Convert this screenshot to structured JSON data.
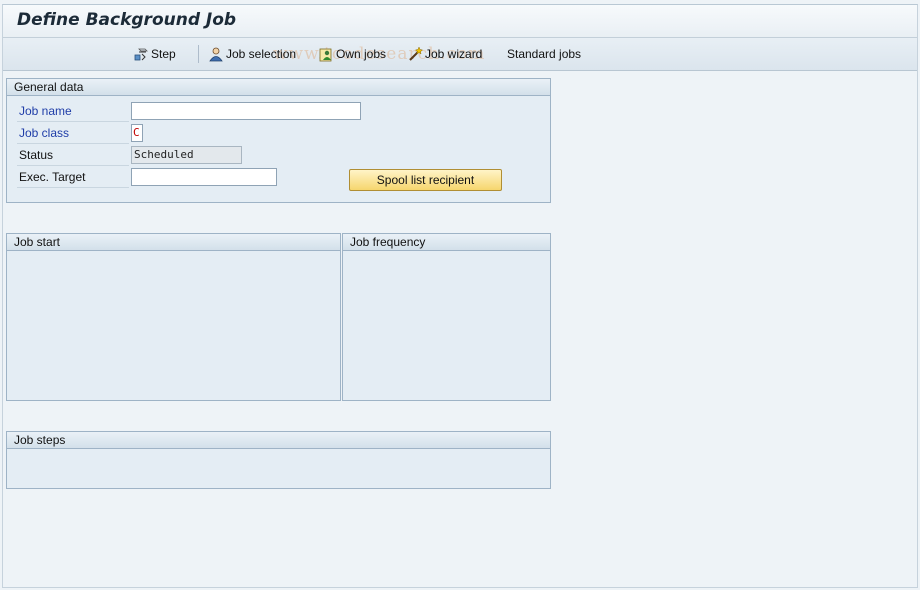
{
  "window": {
    "title": "Define Background Job"
  },
  "toolbar": {
    "items": [
      {
        "label": "Step",
        "icon": "step-icon"
      },
      {
        "label": "Job selection",
        "icon": "job-selection-icon"
      },
      {
        "label": "Own jobs",
        "icon": "own-jobs-icon"
      },
      {
        "label": "Job wizard",
        "icon": "job-wizard-icon"
      },
      {
        "label": "Standard jobs",
        "icon": ""
      }
    ]
  },
  "watermark": "www.tcodesearch.com",
  "general_data": {
    "title": "General data",
    "fields": {
      "job_name": {
        "label": "Job name",
        "value": ""
      },
      "job_class": {
        "label": "Job class",
        "value": "C"
      },
      "status": {
        "label": "Status",
        "value": "Scheduled"
      },
      "exec_target": {
        "label": "Exec. Target",
        "value": ""
      }
    },
    "spool_button": "Spool list recipient"
  },
  "job_start": {
    "title": "Job start"
  },
  "job_frequency": {
    "title": "Job frequency"
  },
  "job_steps": {
    "title": "Job steps"
  }
}
